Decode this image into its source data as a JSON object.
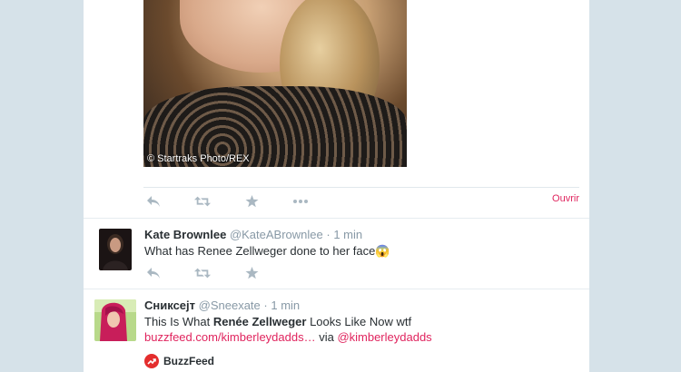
{
  "photo": {
    "credit": "© Startraks Photo/REX"
  },
  "top_tweet": {
    "open_label": "Ouvrir"
  },
  "tweets": [
    {
      "display_name": "Kate Brownlee",
      "handle": "@KateABrownlee",
      "separator": "·",
      "time": "1 min",
      "text": "What has Renee Zellweger done to her face😱"
    },
    {
      "display_name": "Сниксејт",
      "handle": "@Sneexate",
      "separator": "·",
      "time": "1 min",
      "text_prefix": "This Is What ",
      "text_bold": "Renée Zellweger",
      "text_suffix": " Looks Like Now wtf",
      "link_url": "buzzfeed.com/kimberleydadds…",
      "via_label": " via ",
      "mention": "@kimberleydadds",
      "card_source": "BuzzFeed"
    }
  ],
  "icons": [
    "reply-icon",
    "retweet-icon",
    "favorite-icon",
    "more-icon",
    "buzzfeed-logo-icon"
  ],
  "colors": {
    "accent": "#e0245e",
    "icon": "#aab8c2",
    "meta": "#8899a6",
    "background": "#d6e2e9"
  }
}
